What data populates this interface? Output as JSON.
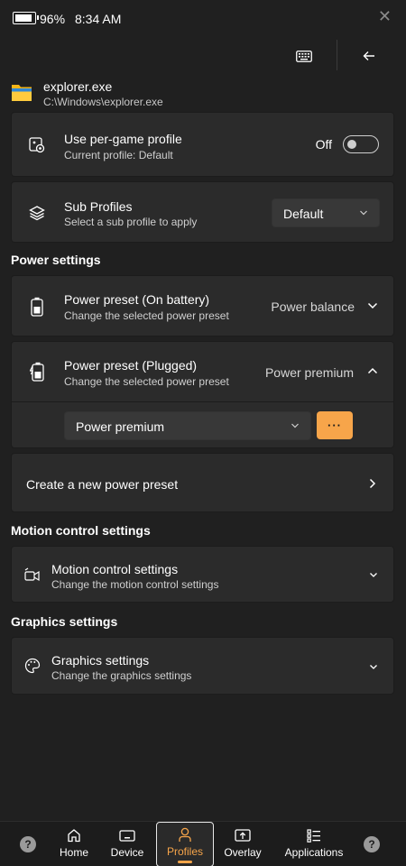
{
  "status": {
    "battery_percent": "96%",
    "battery_level": 0.96,
    "time": "8:34 AM",
    "close_glyph": "✕"
  },
  "toolbar": {
    "keyboard_icon": "keyboard-icon",
    "back_icon": "back-arrow-icon"
  },
  "app": {
    "name": "explorer.exe",
    "path": "C:\\Windows\\explorer.exe"
  },
  "profile_card": {
    "title": "Use per-game profile",
    "subtitle": "Current profile: Default",
    "toggle_label": "Off"
  },
  "subprofile_card": {
    "title": "Sub Profiles",
    "subtitle": "Select a sub profile to apply",
    "selected": "Default"
  },
  "power": {
    "heading": "Power settings",
    "battery": {
      "title": "Power preset (On battery)",
      "subtitle": "Change the selected power preset",
      "value": "Power balance"
    },
    "plugged": {
      "title": "Power preset (Plugged)",
      "subtitle": "Change the selected power preset",
      "value": "Power premium",
      "dropdown": "Power premium",
      "more_label": "···"
    },
    "create": {
      "label": "Create a new power preset"
    }
  },
  "motion": {
    "heading": "Motion control settings",
    "title": "Motion control settings",
    "subtitle": "Change the motion control settings"
  },
  "graphics": {
    "heading": "Graphics settings",
    "title": "Graphics settings",
    "subtitle": "Change the graphics settings"
  },
  "nav": {
    "help_glyph": "?",
    "items": [
      {
        "label": "Home",
        "icon": "home-icon"
      },
      {
        "label": "Device",
        "icon": "device-icon"
      },
      {
        "label": "Profiles",
        "icon": "profile-icon"
      },
      {
        "label": "Overlay",
        "icon": "overlay-icon"
      },
      {
        "label": "Applications",
        "icon": "applications-icon"
      }
    ]
  },
  "colors": {
    "accent": "#f7a54a",
    "background": "#202020",
    "card": "#2b2b2b"
  }
}
